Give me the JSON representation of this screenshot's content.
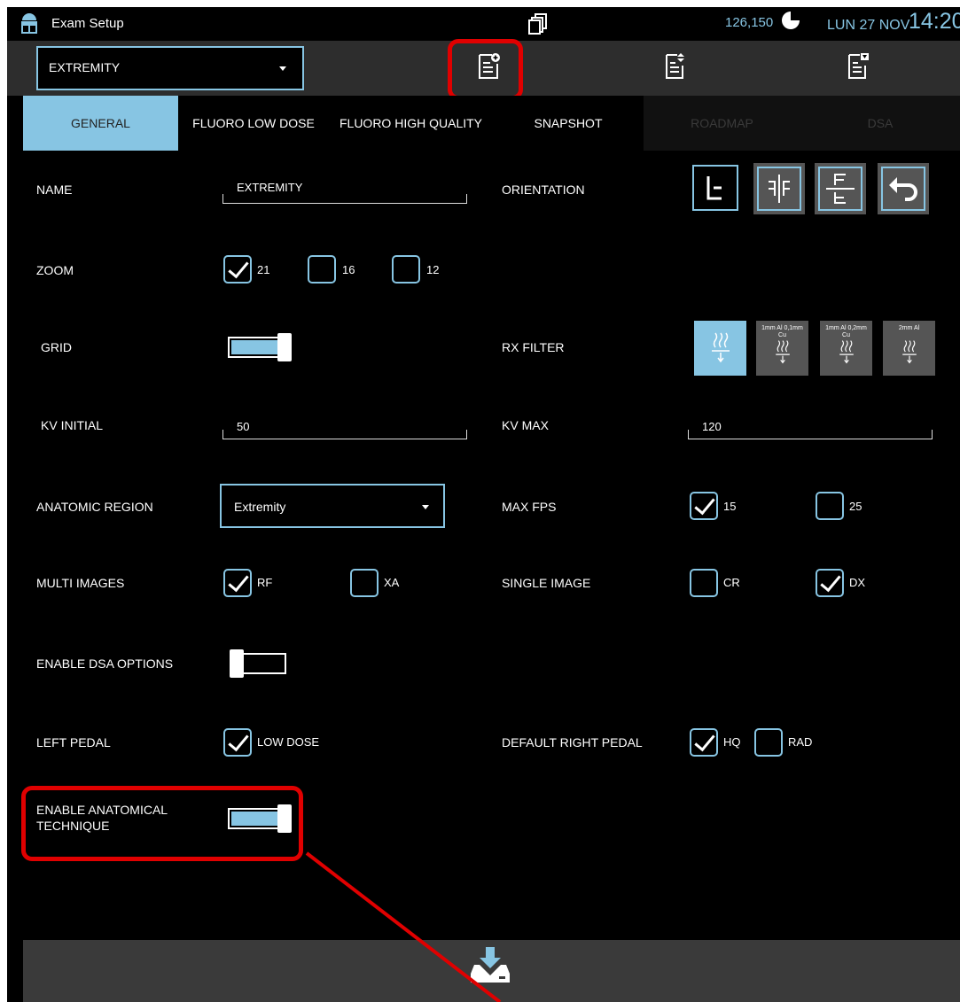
{
  "status": {
    "title": "Exam Setup",
    "counter": "126,150",
    "date": "LUN 27 NOV",
    "time": "14:20"
  },
  "toolbar": {
    "exam_select": "EXTREMITY",
    "icons": [
      "new-exam-icon",
      "move-exam-icon",
      "exam-list-icon"
    ]
  },
  "tabs": [
    {
      "label": "GENERAL",
      "state": "active"
    },
    {
      "label": "FLUORO LOW DOSE",
      "state": "normal"
    },
    {
      "label": "FLUORO HIGH QUALITY",
      "state": "normal"
    },
    {
      "label": "SNAPSHOT",
      "state": "normal"
    },
    {
      "label": "ROADMAP",
      "state": "disabled"
    },
    {
      "label": "DSA",
      "state": "disabled"
    }
  ],
  "form": {
    "name_label": "NAME",
    "name_value": "EXTREMITY",
    "orientation_label": "ORIENTATION",
    "zoom_label": "ZOOM",
    "zoom_options": [
      {
        "label": "21",
        "checked": true
      },
      {
        "label": "16",
        "checked": false
      },
      {
        "label": "12",
        "checked": false
      }
    ],
    "grid_label": "GRID",
    "grid_on": true,
    "rx_filter_label": "RX FILTER",
    "rx_filters": [
      {
        "label": "",
        "active": true
      },
      {
        "label": "1mm Al 0,1mm Cu",
        "active": false
      },
      {
        "label": "1mm Al 0,2mm Cu",
        "active": false
      },
      {
        "label": "2mm Al",
        "active": false
      }
    ],
    "kv_initial_label": "KV INITIAL",
    "kv_initial_value": "50",
    "kv_max_label": "KV MAX",
    "kv_max_value": "120",
    "anatomic_region_label": "ANATOMIC REGION",
    "anatomic_region_value": "Extremity",
    "max_fps_label": "MAX FPS",
    "max_fps_options": [
      {
        "label": "15",
        "checked": true
      },
      {
        "label": "25",
        "checked": false
      }
    ],
    "multi_images_label": "MULTI IMAGES",
    "multi_images_options": [
      {
        "label": "RF",
        "checked": true
      },
      {
        "label": "XA",
        "checked": false
      }
    ],
    "single_image_label": "SINGLE IMAGE",
    "single_image_options": [
      {
        "label": "CR",
        "checked": false
      },
      {
        "label": "DX",
        "checked": true
      }
    ],
    "enable_dsa_label": "ENABLE DSA OPTIONS",
    "enable_dsa_on": false,
    "left_pedal_label": "LEFT PEDAL",
    "left_pedal_option": {
      "label": "LOW DOSE",
      "checked": true
    },
    "right_pedal_label": "DEFAULT RIGHT PEDAL",
    "right_pedal_options": [
      {
        "label": "HQ",
        "checked": true
      },
      {
        "label": "RAD",
        "checked": false
      }
    ],
    "anatomical_label_1": "ENABLE ANATOMICAL",
    "anatomical_label_2": "TECHNIQUE",
    "anatomical_on": true
  },
  "colors": {
    "accent": "#87c5e3",
    "highlight": "#e00000",
    "toolbar": "#2d2d2d"
  }
}
